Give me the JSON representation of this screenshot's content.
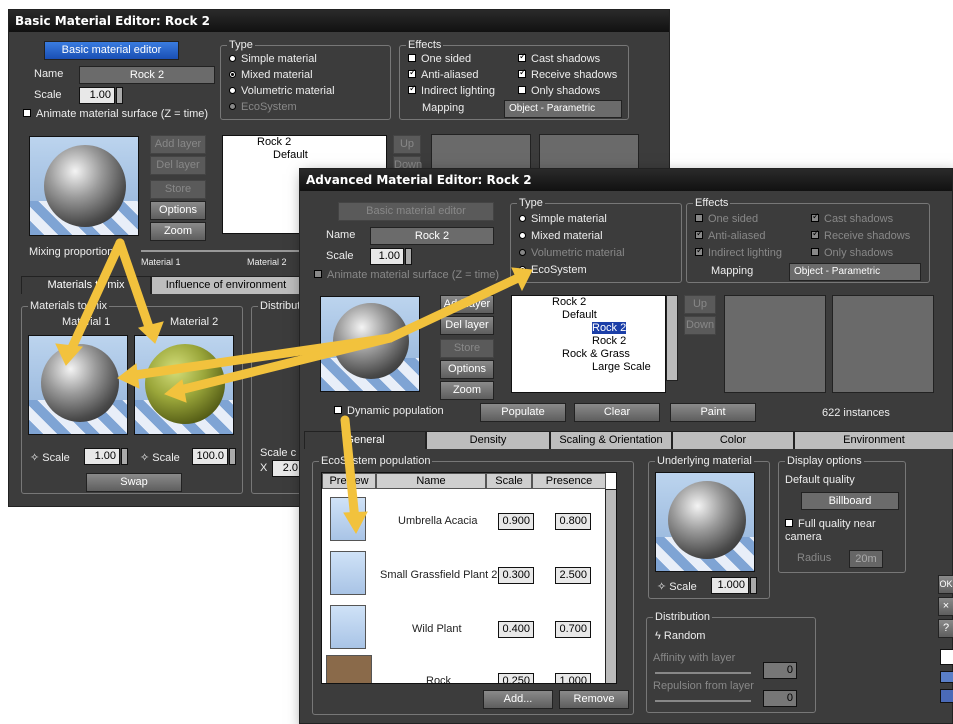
{
  "basic": {
    "title": "Basic Material Editor: Rock 2",
    "header_btn": "Basic material editor",
    "name_label": "Name",
    "name_value": "Rock 2",
    "scale_label": "Scale",
    "scale_value": "1.00",
    "animate_label": "Animate material surface (Z = time)",
    "type_title": "Type",
    "types": [
      "Simple material",
      "Mixed material",
      "Volumetric material",
      "EcoSystem"
    ],
    "effects_title": "Effects",
    "effects_left": [
      "One sided",
      "Anti-aliased",
      "Indirect lighting"
    ],
    "effects_right": [
      "Cast shadows",
      "Receive shadows",
      "Only shadows"
    ],
    "mapping_label": "Mapping",
    "mapping_value": "Object - Parametric",
    "buttons": [
      "Add layer",
      "Del layer",
      "Store",
      "Options",
      "Zoom"
    ],
    "up": "Up",
    "down": "Down",
    "tree": [
      "Rock 2",
      "Default"
    ],
    "mixing_label": "Mixing proportions",
    "mat1_label": "Material 1",
    "mat2_label": "Material 2",
    "tabs": [
      "Materials to mix",
      "Influence of environment"
    ],
    "mix_group": "Materials to mix",
    "dist_group": "Distributio",
    "m1": "Material 1",
    "m2": "Material 2",
    "scale1": "1.00",
    "scale2": "100.0",
    "swap": "Swap",
    "scale_lbl": "Scale",
    "scale_c": "Scale c",
    "x_lbl": "X",
    "x_val": "2.0"
  },
  "adv": {
    "title": "Advanced Material Editor: Rock 2",
    "header_btn": "Basic material editor",
    "name_label": "Name",
    "name_value": "Rock 2",
    "scale_label": "Scale",
    "scale_value": "1.00",
    "animate_label": "Animate material surface (Z = time)",
    "type_title": "Type",
    "types": [
      "Simple material",
      "Mixed material",
      "Volumetric material",
      "EcoSystem"
    ],
    "effects_title": "Effects",
    "effects_left": [
      "One sided",
      "Anti-aliased",
      "Indirect lighting"
    ],
    "effects_right": [
      "Cast shadows",
      "Receive shadows",
      "Only shadows"
    ],
    "mapping_label": "Mapping",
    "mapping_value": "Object - Parametric",
    "buttons": [
      "Add layer",
      "Del layer",
      "Store",
      "Options",
      "Zoom"
    ],
    "up": "Up",
    "down": "Down",
    "tree": [
      "Rock 2",
      "Default",
      "Rock 2",
      "Rock 2",
      "Rock & Grass",
      "Large Scale"
    ],
    "dynamic": "Dynamic population",
    "populate": "Populate",
    "clear": "Clear",
    "paint": "Paint",
    "instances": "622 instances",
    "tabs": [
      "General",
      "Density",
      "Scaling & Orientation",
      "Color",
      "Environment"
    ],
    "eco_title": "EcoSystem population",
    "cols": [
      "Preview",
      "Name",
      "Scale",
      "Presence"
    ],
    "rows": [
      {
        "name": "Umbrella Acacia",
        "scale": "0.900",
        "presence": "0.800"
      },
      {
        "name": "Small Grassfield Plant 2",
        "scale": "0.300",
        "presence": "2.500"
      },
      {
        "name": "Wild Plant",
        "scale": "0.400",
        "presence": "0.700"
      },
      {
        "name": "Rock",
        "scale": "0.250",
        "presence": "1.000"
      }
    ],
    "add": "Add...",
    "remove": "Remove",
    "under_title": "Underlying material",
    "under_scale_lbl": "Scale",
    "under_scale": "1.000",
    "display_title": "Display options",
    "default_quality": "Default quality",
    "quality_value": "Billboard",
    "full_quality": "Full quality near camera",
    "radius_lbl": "Radius",
    "radius_val": "20m",
    "dist_title": "Distribution",
    "random": "Random",
    "affinity": "Affinity with layer",
    "repulsion": "Repulsion from layer",
    "aff_val": "0",
    "rep_val": "0",
    "side_ok": "OK",
    "side_x": "×",
    "side_q": "?"
  },
  "colors": {
    "accent": "#f2c23d",
    "title_bg": "#111111",
    "panel": "#3c3c3c",
    "selection": "#1c3fa8"
  }
}
